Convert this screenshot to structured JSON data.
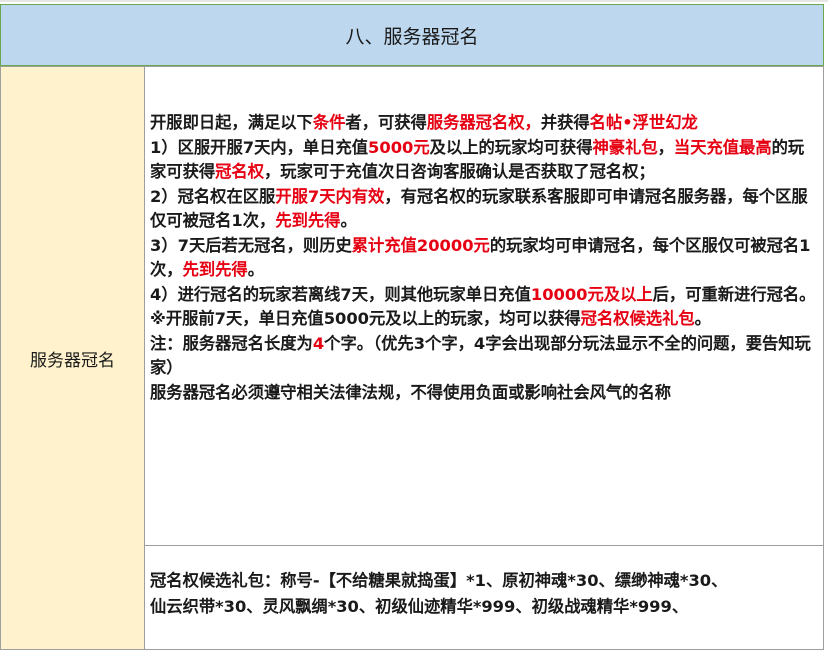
{
  "header": {
    "title": "八、服务器冠名"
  },
  "left_label": "服务器冠名",
  "rules": [
    [
      {
        "t": "开服即日起，满足以下",
        "hl": false
      },
      {
        "t": "条件",
        "hl": true
      },
      {
        "t": "者，可获得",
        "hl": false
      },
      {
        "t": "服务器冠名权，",
        "hl": true
      },
      {
        "t": "并获得",
        "hl": false
      },
      {
        "t": "名帖•浮世幻龙",
        "hl": true
      }
    ],
    [
      {
        "t": "1）区服开服7天内，单日充值",
        "hl": false
      },
      {
        "t": "5000元",
        "hl": true
      },
      {
        "t": "及以上的玩家均可获得",
        "hl": false
      },
      {
        "t": "神豪礼包",
        "hl": true
      },
      {
        "t": "，",
        "hl": false
      },
      {
        "t": "当天充值最高",
        "hl": true
      },
      {
        "t": "的玩家可获得",
        "hl": false
      },
      {
        "t": "冠名权",
        "hl": true
      },
      {
        "t": "，玩家可于充值次日咨询客服确认是否获取了冠名权；",
        "hl": false
      }
    ],
    [
      {
        "t": "2）冠名权在区服",
        "hl": false
      },
      {
        "t": "开服7天内有效",
        "hl": true
      },
      {
        "t": "，有冠名权的玩家联系客服即可申请冠名服务器，每个区服仅可被冠名1次，",
        "hl": false
      },
      {
        "t": "先到先得",
        "hl": true
      },
      {
        "t": "。",
        "hl": false
      }
    ],
    [
      {
        "t": "3）7天后若无冠名，则历史",
        "hl": false
      },
      {
        "t": "累计充值20000元",
        "hl": true
      },
      {
        "t": "的玩家均可申请冠名，每个区服仅可被冠名1次，",
        "hl": false
      },
      {
        "t": "先到先得",
        "hl": true
      },
      {
        "t": "。",
        "hl": false
      }
    ],
    [
      {
        "t": "4）进行冠名的玩家若离线7天，则其他玩家单日充值",
        "hl": false
      },
      {
        "t": "10000元及以上",
        "hl": true
      },
      {
        "t": "后，可重新进行冠名。",
        "hl": false
      }
    ],
    [
      {
        "t": "※开服前7天，单日充值5000元及以上的玩家，均可以获得",
        "hl": false
      },
      {
        "t": "冠名权候选礼包",
        "hl": true
      },
      {
        "t": "。",
        "hl": false
      }
    ],
    [
      {
        "t": "注：服务器冠名长度为",
        "hl": false
      },
      {
        "t": "4",
        "hl": true
      },
      {
        "t": "个字。（优先3个字，4字会出现部分玩法显示不全的问题，要告知玩家）",
        "hl": false
      }
    ],
    [
      {
        "t": "服务器冠名必须遵守相关法律法规，不得使用负面或影响社会风气的名称",
        "hl": false
      }
    ]
  ],
  "candidate_pack": {
    "line1": "冠名权候选礼包：称号-【不给糖果就捣蛋】*1、原初神魂*30、缥缈神魂*30、",
    "line2": "仙云织带*30、灵风飘绸*30、初级仙迹精华*999、初级战魂精华*999、"
  },
  "colors": {
    "header_bg": "#bdd7ee",
    "label_bg": "#fff2cc",
    "highlight": "#e60012"
  }
}
